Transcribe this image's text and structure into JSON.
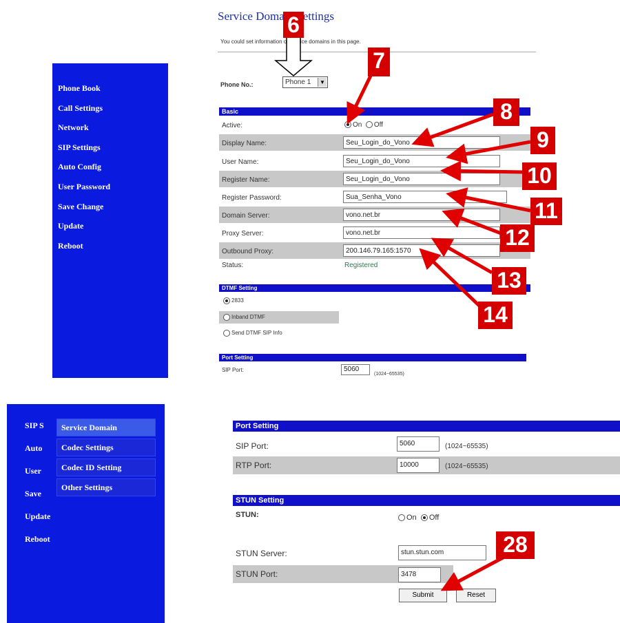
{
  "top": {
    "title": "Service Domain Settings",
    "subtitle": "You could set information of service domains in this page.",
    "sidebar": [
      "Phone Book",
      "Call Settings",
      "Network",
      "SIP Settings",
      "Auto Config",
      "User Password",
      "Save Change",
      "Update",
      "Reboot"
    ],
    "phone_no_label": "Phone No.:",
    "phone_no_value": "Phone 1",
    "basic_header": "Basic",
    "active_label": "Active:",
    "active_on": "On",
    "active_off": "Off",
    "display_name_label": "Display Name:",
    "display_name_value": "Seu_Login_do_Vono",
    "user_name_label": "User Name:",
    "user_name_value": "Seu_Login_do_Vono",
    "register_name_label": "Register Name:",
    "register_name_value": "Seu_Login_do_Vono",
    "register_password_label": "Register Password:",
    "register_password_value": "Sua_Senha_Vono",
    "domain_server_label": "Domain Server:",
    "domain_server_value": "vono.net.br",
    "proxy_server_label": "Proxy Server:",
    "proxy_server_value": "vono.net.br",
    "outbound_proxy_label": "Outbound Proxy:",
    "outbound_proxy_value": "200.146.79.165:1570",
    "status_label": "Status:",
    "status_value": "Registered",
    "dtmf_header": "DTMF Setting",
    "dtmf_opt1": "2833",
    "dtmf_opt2": "Inband DTMF",
    "dtmf_opt3": "Send DTMF SIP Info",
    "port_header": "Port Setting",
    "sip_port_label": "SIP Port:",
    "sip_port_value": "5060",
    "sip_port_range": "(1024~65535)"
  },
  "badges": [
    "6",
    "7",
    "8",
    "9",
    "10",
    "11",
    "12",
    "13",
    "14",
    "28"
  ],
  "bottom": {
    "sidebar_partial": [
      "SIP S",
      "Auto",
      "User",
      "Save"
    ],
    "sidebar": [
      "Update",
      "Reboot"
    ],
    "submenu": [
      "Service Domain",
      "Codec Settings",
      "Codec ID Setting",
      "Other Settings"
    ],
    "port_header": "Port Setting",
    "sip_port_label": "SIP Port:",
    "sip_port_value": "5060",
    "sip_port_range": "(1024~65535)",
    "rtp_port_label": "RTP Port:",
    "rtp_port_value": "10000",
    "rtp_port_range": "(1024~65535)",
    "stun_header": "STUN Setting",
    "stun_label": "STUN:",
    "stun_on": "On",
    "stun_off": "Off",
    "stun_server_label": "STUN Server:",
    "stun_server_value": "stun.stun.com",
    "stun_port_label": "STUN Port:",
    "stun_port_value": "3478",
    "submit": "Submit",
    "reset": "Reset"
  },
  "colors": {
    "sidebar": "#0a1adf",
    "header_bar": "#1010c8",
    "badge": "#d40000",
    "arrow": "#e00000"
  }
}
